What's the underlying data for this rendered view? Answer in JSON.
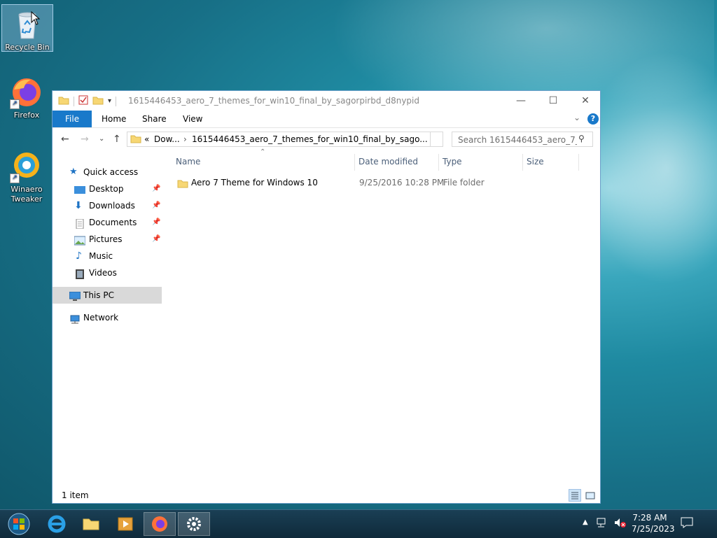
{
  "desktop": {
    "icons": [
      {
        "label": "Recycle Bin",
        "icon": "recycle-bin-icon"
      },
      {
        "label": "Firefox",
        "icon": "firefox-icon"
      },
      {
        "label": "Winaero Tweaker",
        "icon": "winaero-tweaker-icon"
      }
    ]
  },
  "window": {
    "title": "1615446453_aero_7_themes_for_win10_final_by_sagorpirbd_d8nypid",
    "controls": {
      "minimize": "—",
      "maximize": "☐",
      "close": "✕"
    },
    "ribbon": {
      "tabs": [
        "File",
        "Home",
        "Share",
        "View"
      ],
      "help": "?",
      "expand": "⌄"
    },
    "address": {
      "overflow": "«",
      "segments": [
        "Dow...",
        "1615446453_aero_7_themes_for_win10_final_by_sago..."
      ],
      "separator": "›"
    },
    "search": {
      "placeholder": "Search 1615446453_aero_7_th..."
    },
    "nav": {
      "quick_access": "Quick access",
      "pinned": [
        {
          "label": "Desktop",
          "pinned": true
        },
        {
          "label": "Downloads",
          "pinned": true
        },
        {
          "label": "Documents",
          "pinned": true
        },
        {
          "label": "Pictures",
          "pinned": true
        },
        {
          "label": "Music",
          "pinned": false
        },
        {
          "label": "Videos",
          "pinned": false
        }
      ],
      "this_pc": "This PC",
      "network": "Network"
    },
    "columns": [
      "Name",
      "Date modified",
      "Type",
      "Size"
    ],
    "files": [
      {
        "name": "Aero 7 Theme for Windows 10",
        "date_modified": "9/25/2016 10:28 PM",
        "type": "File folder",
        "size": ""
      }
    ],
    "status": {
      "items": "1 item"
    }
  },
  "taskbar": {
    "apps": [
      "start-orb",
      "internet-explorer",
      "file-explorer",
      "media-player",
      "firefox",
      "settings"
    ],
    "clock": {
      "time": "7:28 AM",
      "date": "7/25/2023"
    }
  },
  "colors": {
    "accent": "#1979ca",
    "selection": "#d9d9d9",
    "header_text": "#4c607a"
  }
}
